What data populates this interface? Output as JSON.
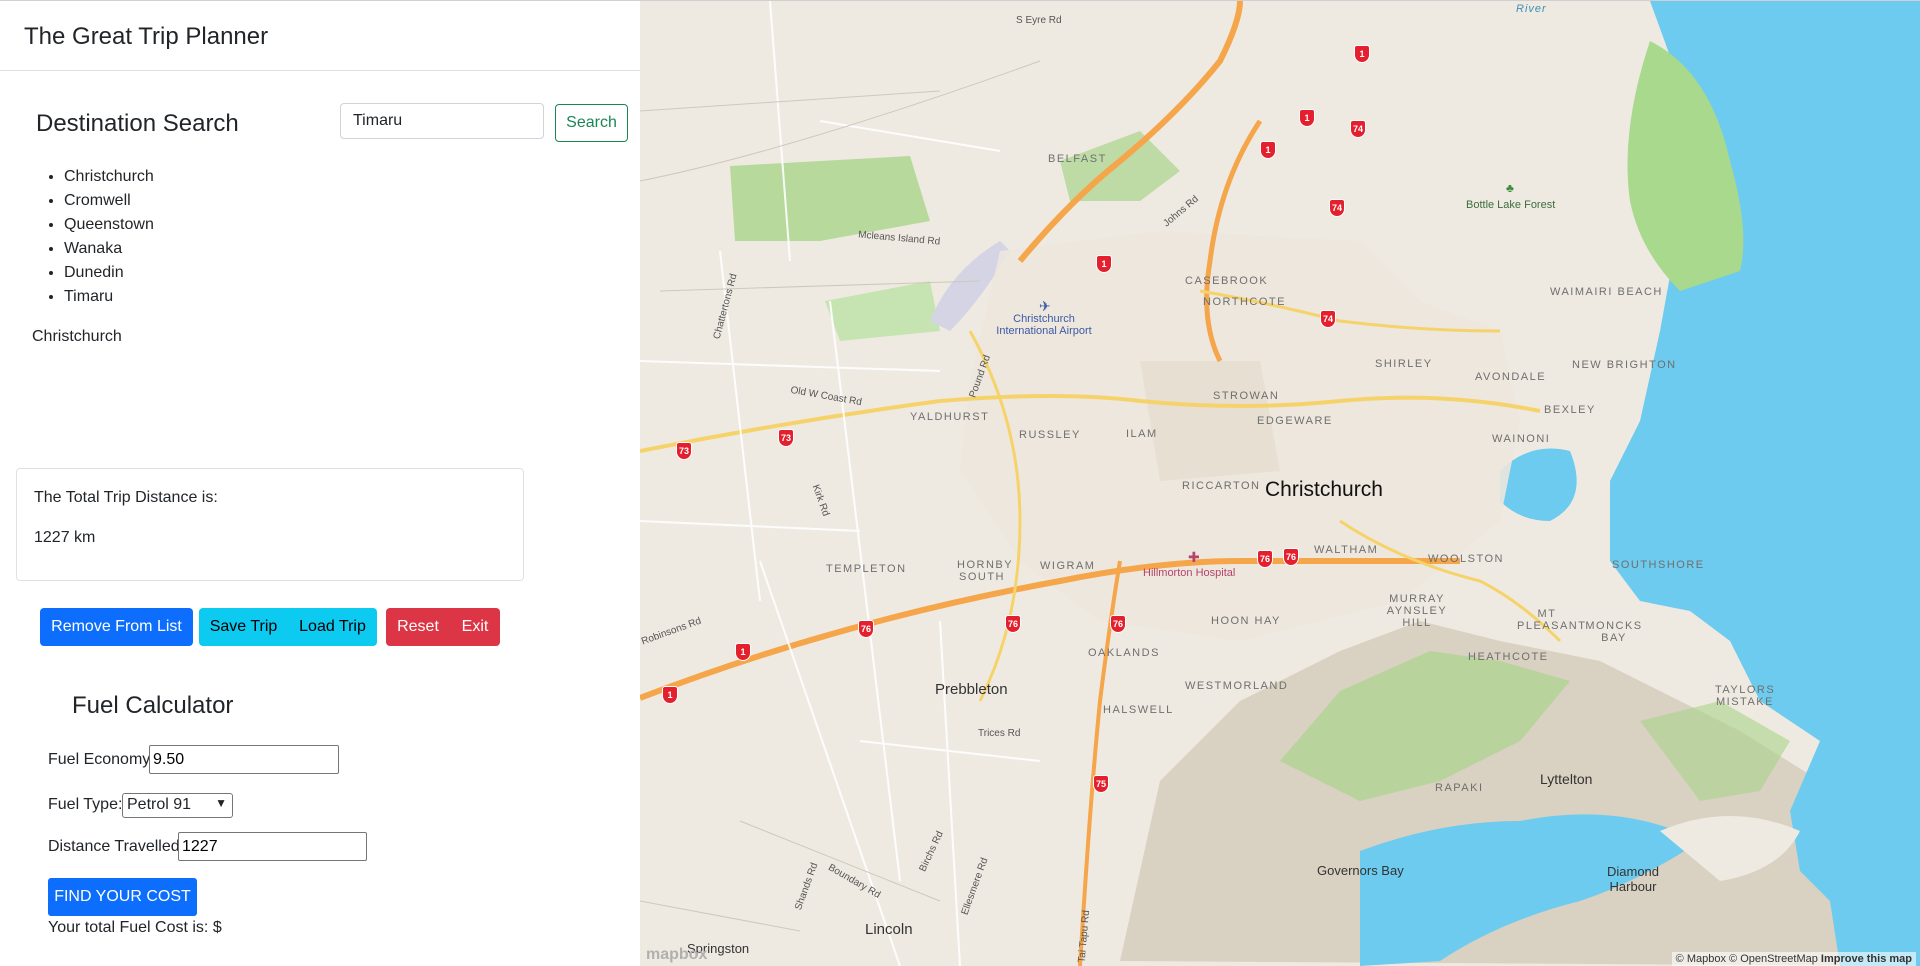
{
  "app": {
    "title": "The Great Trip Planner"
  },
  "search": {
    "heading": "Destination Search",
    "input_value": "Timaru",
    "button_label": "Search"
  },
  "destinations": [
    "Christchurch",
    "Cromwell",
    "Queenstown",
    "Wanaka",
    "Dunedin",
    "Timaru"
  ],
  "selected_city": "Christchurch",
  "distance": {
    "label": "The Total Trip Distance is:",
    "value": "1227 km"
  },
  "actions": {
    "remove": "Remove From List",
    "save": "Save Trip",
    "load": "Load Trip",
    "reset": "Reset",
    "exit": "Exit"
  },
  "fuel": {
    "heading": "Fuel Calculator",
    "economy_label": "Fuel Economy:",
    "economy_value": "9.50",
    "type_label": "Fuel Type:",
    "type_value": "Petrol 91",
    "distance_label": "Distance Travelled:",
    "distance_value": "1227",
    "button_label": "FIND YOUR COST",
    "result_text": "Your total Fuel Cost is: $"
  },
  "map": {
    "colors": {
      "land": "#efeae1",
      "water": "#6ccbee",
      "park": "#b7e0a0",
      "hills": "#d6cfc0",
      "highway": "#f5a54a",
      "road": "#f6d36a"
    },
    "city_label": "Christchurch",
    "suburbs": [
      "BELFAST",
      "CASEBROOK",
      "NORTHCOTE",
      "SHIRLEY",
      "AVONDALE",
      "NEW BRIGHTON",
      "WAIMAIRI BEACH",
      "STROWAN",
      "RUSSLEY",
      "ILAM",
      "EDGEWARE",
      "BEXLEY",
      "WAINONI",
      "YALDHURST",
      "RICCARTON",
      "WALTHAM",
      "WOOLSTON",
      "SOUTHSHORE",
      "HORNBY SOUTH",
      "WIGRAM",
      "TEMPLETON",
      "MURRAY AYNSLEY HILL",
      "HOON HAY",
      "OAKLANDS",
      "MT PLEASANT",
      "MONCKS BAY",
      "HEATHCOTE",
      "WESTMORLAND",
      "HALSWELL",
      "TAYLORS MISTAKE",
      "RAPAKI"
    ],
    "towns": [
      "Prebbleton",
      "Lincoln",
      "Lyttelton",
      "Governors Bay",
      "Diamond Harbour",
      "Springston"
    ],
    "roads": [
      "S Eyre Rd",
      "Mcleans Island Rd",
      "Johns Rd",
      "Chattertons Rd",
      "Old W Coast Rd",
      "Pound Rd",
      "Kirk Rd",
      "Trices Rd",
      "Birchs Rd",
      "Shands Rd",
      "Boundary Rd",
      "Ellesmere Rd",
      "Tai Tapu Rd",
      "Robinsons Rd"
    ],
    "pois": {
      "airport": "Christchurch International Airport",
      "hospital": "Hillmorton Hospital",
      "forest": "Bottle Lake Forest",
      "river": "River"
    },
    "shields": [
      "1",
      "1",
      "1",
      "74",
      "74",
      "74",
      "76",
      "76",
      "76",
      "76",
      "76",
      "73",
      "73",
      "75",
      "1",
      "1",
      "1"
    ],
    "attribution": {
      "mapbox": "© Mapbox",
      "osm": "© OpenStreetMap",
      "improve": "Improve this map"
    },
    "logo": "mapbox"
  }
}
